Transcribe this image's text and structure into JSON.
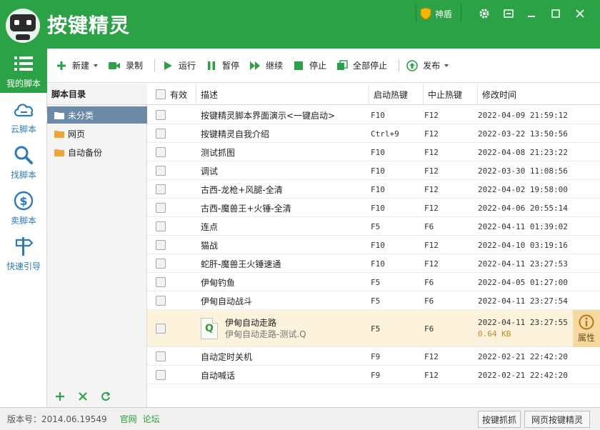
{
  "app": {
    "title": "按键精灵",
    "shield_label": "神盾",
    "accent": "#2aa245"
  },
  "nav": {
    "items": [
      {
        "label": "我的脚本",
        "icon": "list-icon",
        "active": true
      },
      {
        "label": "云脚本",
        "icon": "cloud-icon"
      },
      {
        "label": "找脚本",
        "icon": "search-icon"
      },
      {
        "label": "卖脚本",
        "icon": "dollar-icon"
      },
      {
        "label": "快速引导",
        "icon": "signpost-icon"
      }
    ]
  },
  "toolbar": {
    "new_label": "新建",
    "record_label": "录制",
    "run_label": "运行",
    "pause_label": "暂停",
    "resume_label": "继续",
    "stop_label": "停止",
    "stop_all_label": "全部停止",
    "publish_label": "发布"
  },
  "folders": {
    "header": "脚本目录",
    "items": [
      "未分类",
      "网页",
      "自动备份"
    ]
  },
  "table": {
    "columns": {
      "enabled": "有效",
      "desc": "描述",
      "start_hotkey": "启动热键",
      "stop_hotkey": "中止热键",
      "modified": "修改时间"
    },
    "rows": [
      {
        "desc": "按键精灵脚本界面演示<一键启动>",
        "start": "F10",
        "stop": "F12",
        "time": "2022-04-09 21:59:12"
      },
      {
        "desc": "按键精灵自我介绍",
        "start": "Ctrl+9",
        "stop": "F12",
        "time": "2022-03-22 13:50:56"
      },
      {
        "desc": "测试抓图",
        "start": "F10",
        "stop": "F12",
        "time": "2022-04-08 21:23:22"
      },
      {
        "desc": "调试",
        "start": "F10",
        "stop": "F12",
        "time": "2022-03-30 11:08:56"
      },
      {
        "desc": "古西-龙枪+风腿-全清",
        "start": "F10",
        "stop": "F12",
        "time": "2022-04-02 19:58:00"
      },
      {
        "desc": "古西-魔兽王+火锤-全清",
        "start": "F10",
        "stop": "F12",
        "time": "2022-04-06 20:55:14"
      },
      {
        "desc": "连点",
        "start": "F5",
        "stop": "F6",
        "time": "2022-04-11 01:39:02"
      },
      {
        "desc": "猫战",
        "start": "F10",
        "stop": "F12",
        "time": "2022-04-10 03:19:16"
      },
      {
        "desc": "蛇肝-魔兽王火锤速通",
        "start": "F10",
        "stop": "F12",
        "time": "2022-04-11 23:27:53"
      },
      {
        "desc": "伊甸钓鱼",
        "start": "F5",
        "stop": "F6",
        "time": "2022-04-05 01:27:00"
      },
      {
        "desc": "伊甸自动战斗",
        "start": "F5",
        "stop": "F6",
        "time": "2022-04-11 23:27:54"
      }
    ],
    "selected_row": {
      "desc": "伊甸自动走路",
      "file": "伊甸自动走路-测试.Q",
      "file_icon_letter": "Q",
      "start": "F5",
      "stop": "F6",
      "time": "2022-04-11 23:27:55",
      "size": "0.64 KB",
      "prop_label": "属性"
    },
    "rows_after": [
      {
        "desc": "自动定时关机",
        "start": "F9",
        "stop": "F12",
        "time": "2022-02-21 22:42:20"
      },
      {
        "desc": "自动喊话",
        "start": "F9",
        "stop": "F12",
        "time": "2022-02-21 22:42:20"
      }
    ]
  },
  "status": {
    "version": "版本号：2014.06.19549",
    "link_official": "官网",
    "link_forum": "论坛",
    "btn_capture": "按键抓抓",
    "btn_web": "网页按键精灵"
  }
}
